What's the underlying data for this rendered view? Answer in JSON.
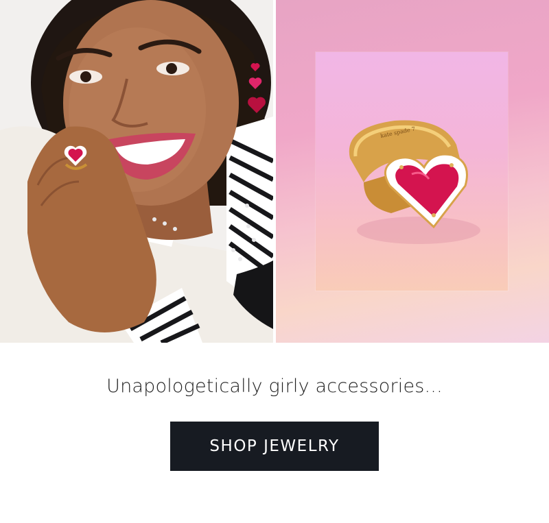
{
  "hero": {
    "left_image": "model-wearing-heart-jewelry",
    "right_image": "heart-ring-product"
  },
  "caption": "Unapologetically girly accessories...",
  "cta": {
    "label": "SHOP JEWELRY"
  },
  "colors": {
    "button_bg": "#171b22",
    "button_text": "#ffffff",
    "caption_text": "#1e1e1e",
    "ruby": "#d4144f"
  }
}
